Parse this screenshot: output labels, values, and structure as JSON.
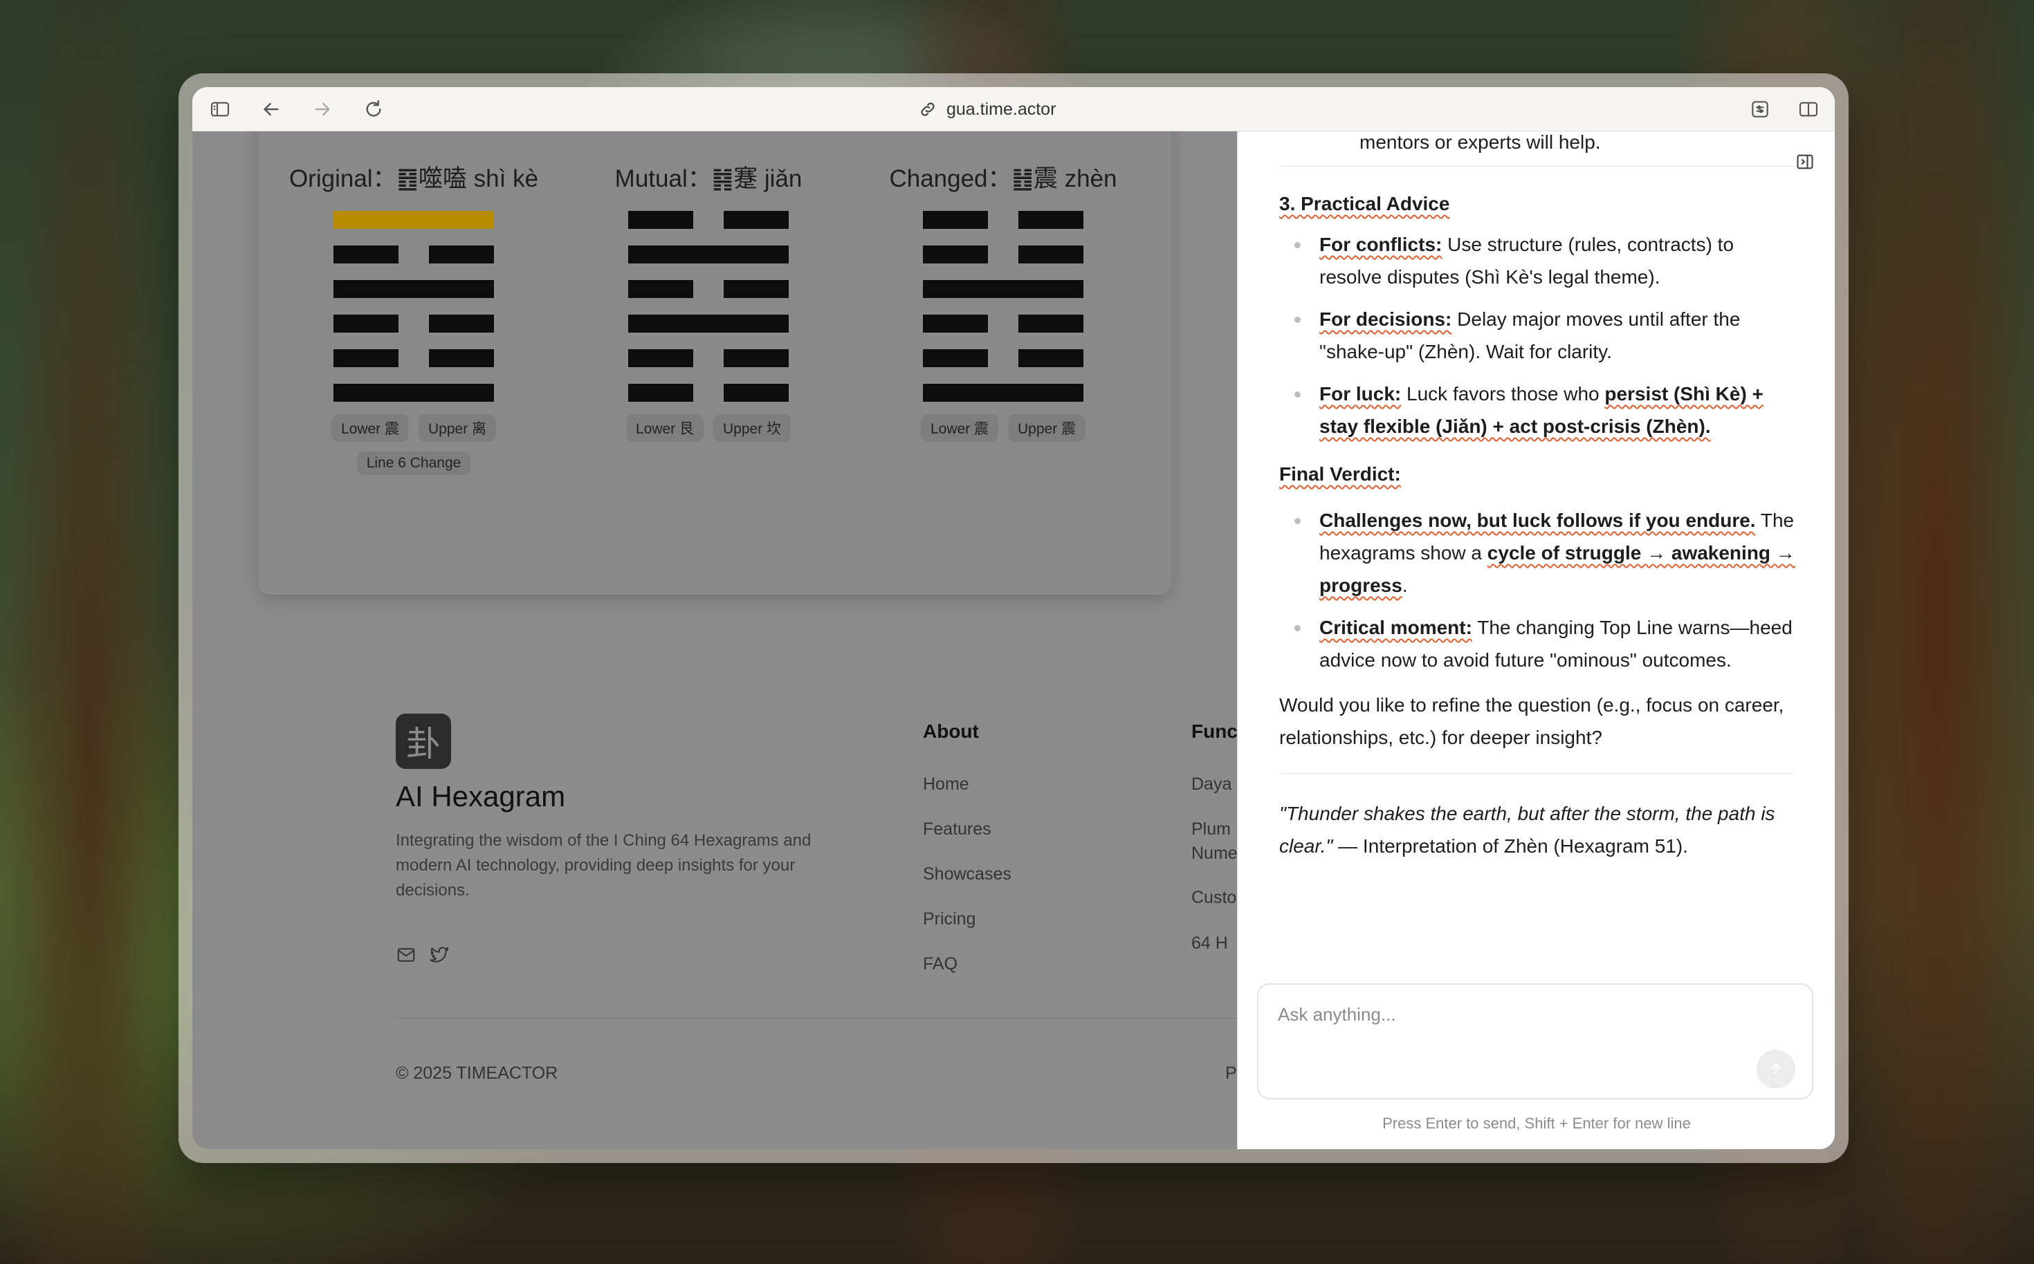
{
  "browser": {
    "url": "gua.time.actor"
  },
  "hexagrams": [
    {
      "title": "Original：䷔噬嗑 shì kè",
      "lines_top_to_bottom": [
        "yang",
        "yin",
        "yang",
        "yin",
        "yin",
        "yang"
      ],
      "highlight_line": 6,
      "tags": [
        "Lower 震",
        "Upper 离"
      ],
      "extra_tag": "Line 6 Change"
    },
    {
      "title": "Mutual：䷦蹇 jiǎn",
      "lines_top_to_bottom": [
        "yin",
        "yang",
        "yin",
        "yang",
        "yin",
        "yin"
      ],
      "tags": [
        "Lower 艮",
        "Upper 坎"
      ]
    },
    {
      "title": "Changed：䷲震 zhèn",
      "lines_top_to_bottom": [
        "yin",
        "yin",
        "yang",
        "yin",
        "yin",
        "yang"
      ],
      "tags": [
        "Lower 震",
        "Upper 震"
      ]
    }
  ],
  "footer": {
    "logo_char": "卦",
    "brand": "AI Hexagram",
    "tagline": "Integrating the wisdom of the I Ching 64 Hexagrams and modern AI technology, providing deep insights for your decisions.",
    "about_title": "About",
    "about_links": [
      "Home",
      "Features",
      "Showcases",
      "Pricing",
      "FAQ"
    ],
    "func_title": "Func",
    "func_links": [
      "Daya",
      "Plum",
      "Nume",
      "Custo",
      "64 H"
    ],
    "copyright": "© 2025 TIMEACTOR",
    "bottom_right_cut": "P"
  },
  "chat": {
    "top_fragment": "mentors or experts will help.",
    "section_heading": "3. Practical Advice",
    "advice": [
      {
        "label": "For conflicts:",
        "text": " Use structure (rules, contracts) to resolve disputes (Shì Kè's legal theme)."
      },
      {
        "label": "For decisions:",
        "text": " Delay major moves until after the \"shake-up\" (Zhèn). Wait for clarity."
      },
      {
        "label": "For luck:",
        "text": " Luck favors those who ",
        "bold_tail": "persist (Shì Kè) + stay flexible (Jiǎn) + act post-crisis (Zhèn)."
      }
    ],
    "verdict_heading": "Final Verdict:",
    "verdict_1_bold": "Challenges now, but luck follows if you endure.",
    "verdict_1_text": " The hexagrams show a ",
    "verdict_1_bold2": "cycle of struggle → awakening → progress",
    "verdict_1_end": ".",
    "verdict_2_label": "Critical moment:",
    "verdict_2_text": " The changing Top Line warns—heed advice now to avoid future \"ominous\" outcomes.",
    "followup": "Would you like to refine the question (e.g., focus on career, relationships, etc.) for deeper insight?",
    "quote_italic": "\"Thunder shakes the earth, but after the storm, the path is clear.\"",
    "quote_rest": " — Interpretation of Zhèn (Hexagram 51).",
    "input_placeholder": "Ask anything...",
    "hint": "Press Enter to send, Shift + Enter for new line"
  }
}
